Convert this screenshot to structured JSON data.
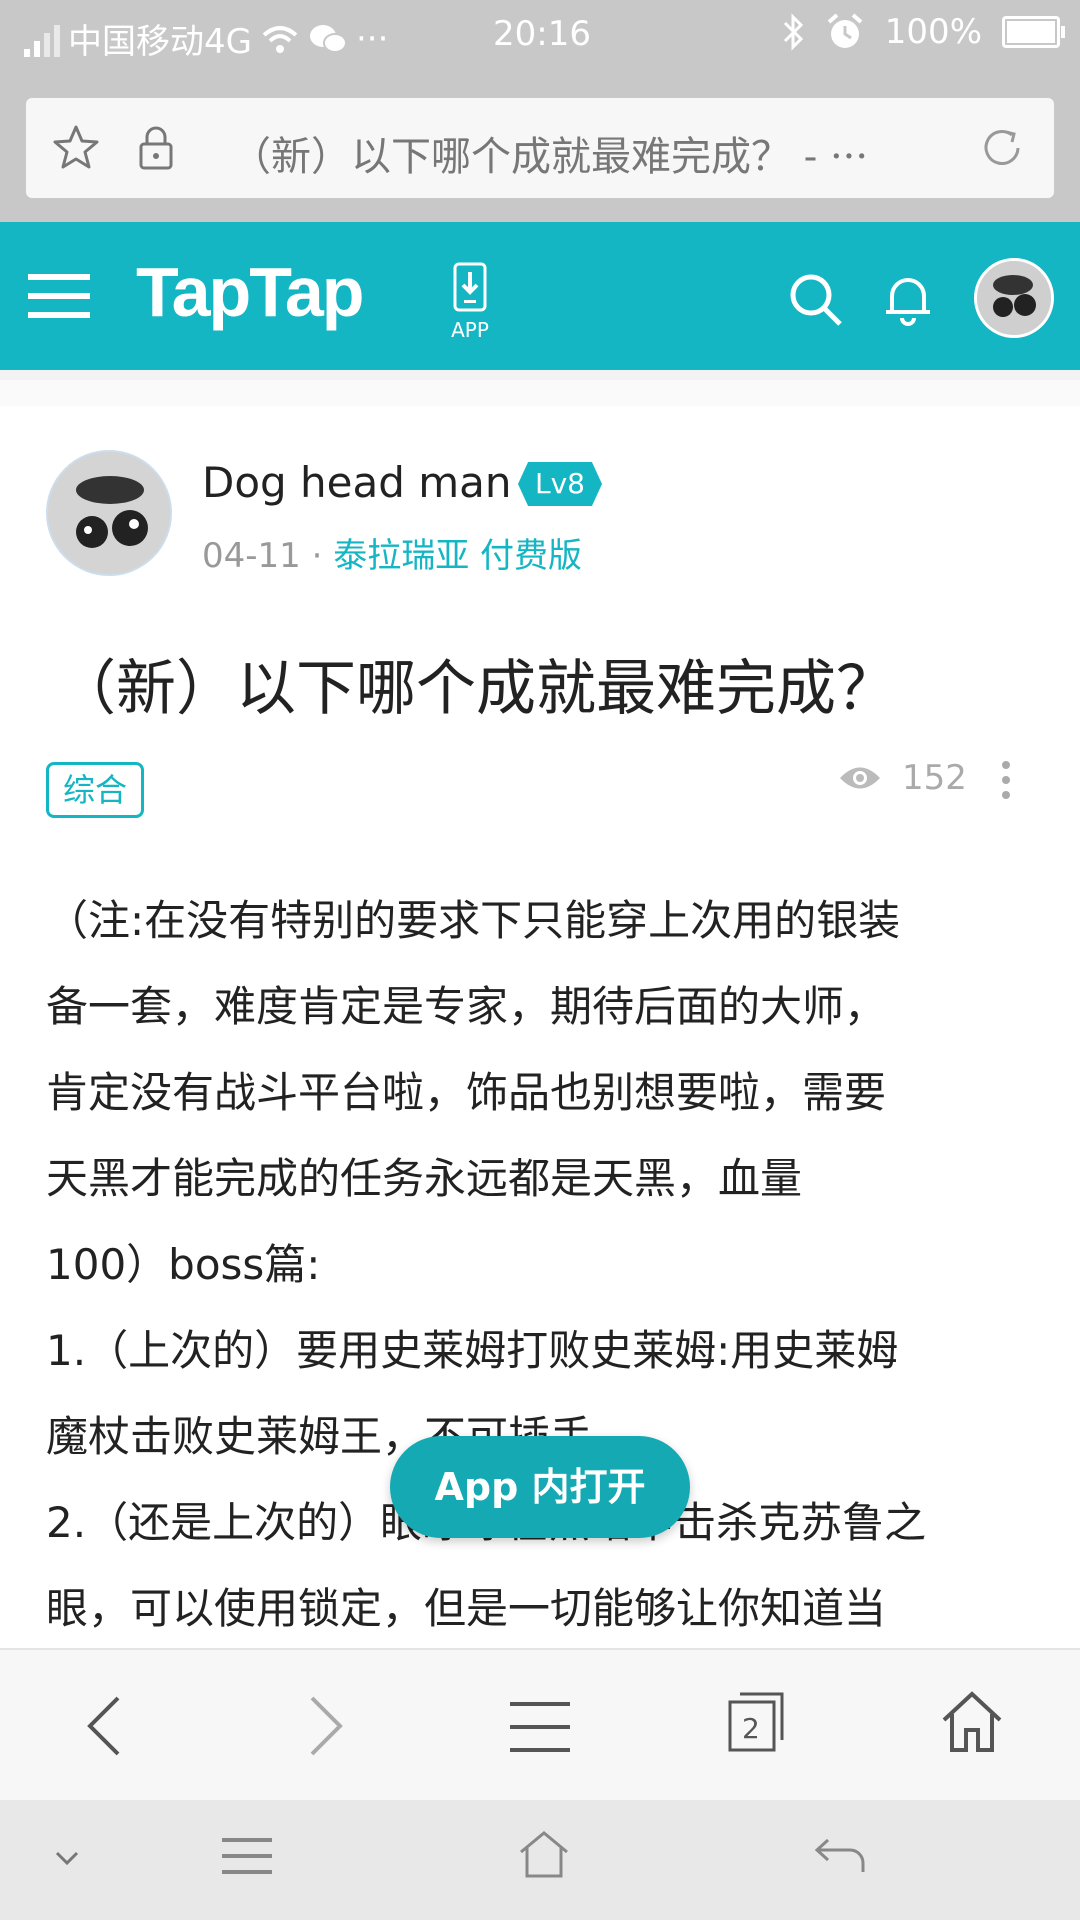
{
  "status_bar": {
    "carrier": "中国移动4G",
    "time": "20:16",
    "battery": "100%"
  },
  "url_bar": {
    "title": "（新）以下哪个成就最难完成？ - ···"
  },
  "app_header": {
    "logo": "TapTap",
    "app_download_label": "APP"
  },
  "post": {
    "author": "Dog head man",
    "level": "Lv8",
    "date": "04-11",
    "separator": "·",
    "game": "泰拉瑞亚 付费版",
    "title": "（新）以下哪个成就最难完成？",
    "category": "综合",
    "views": "152",
    "content": [
      "（注:在没有特别的要求下只能穿上次用的银装",
      "备一套，难度肯定是专家，期待后面的大师，",
      "肯定没有战斗平台啦，饰品也别想要啦，需要",
      "天黑才能完成的任务永远都是天黑，血量",
      "100）boss篇:",
      "1.（上次的）要用史莱姆打败史莱姆:用史莱姆",
      "魔杖击败史莱姆王，不可插手。",
      "2.（还是上次的）眼睁睁在黑暗中击杀克苏鲁之",
      "眼，可以使用锁定，但是一切能够让你知道当"
    ]
  },
  "open_app_button": "App 内打开",
  "browser_toolbar": {
    "tab_count": "2"
  },
  "colors": {
    "brand": "#15b6c4",
    "status_bar": "#c8c8c8"
  }
}
